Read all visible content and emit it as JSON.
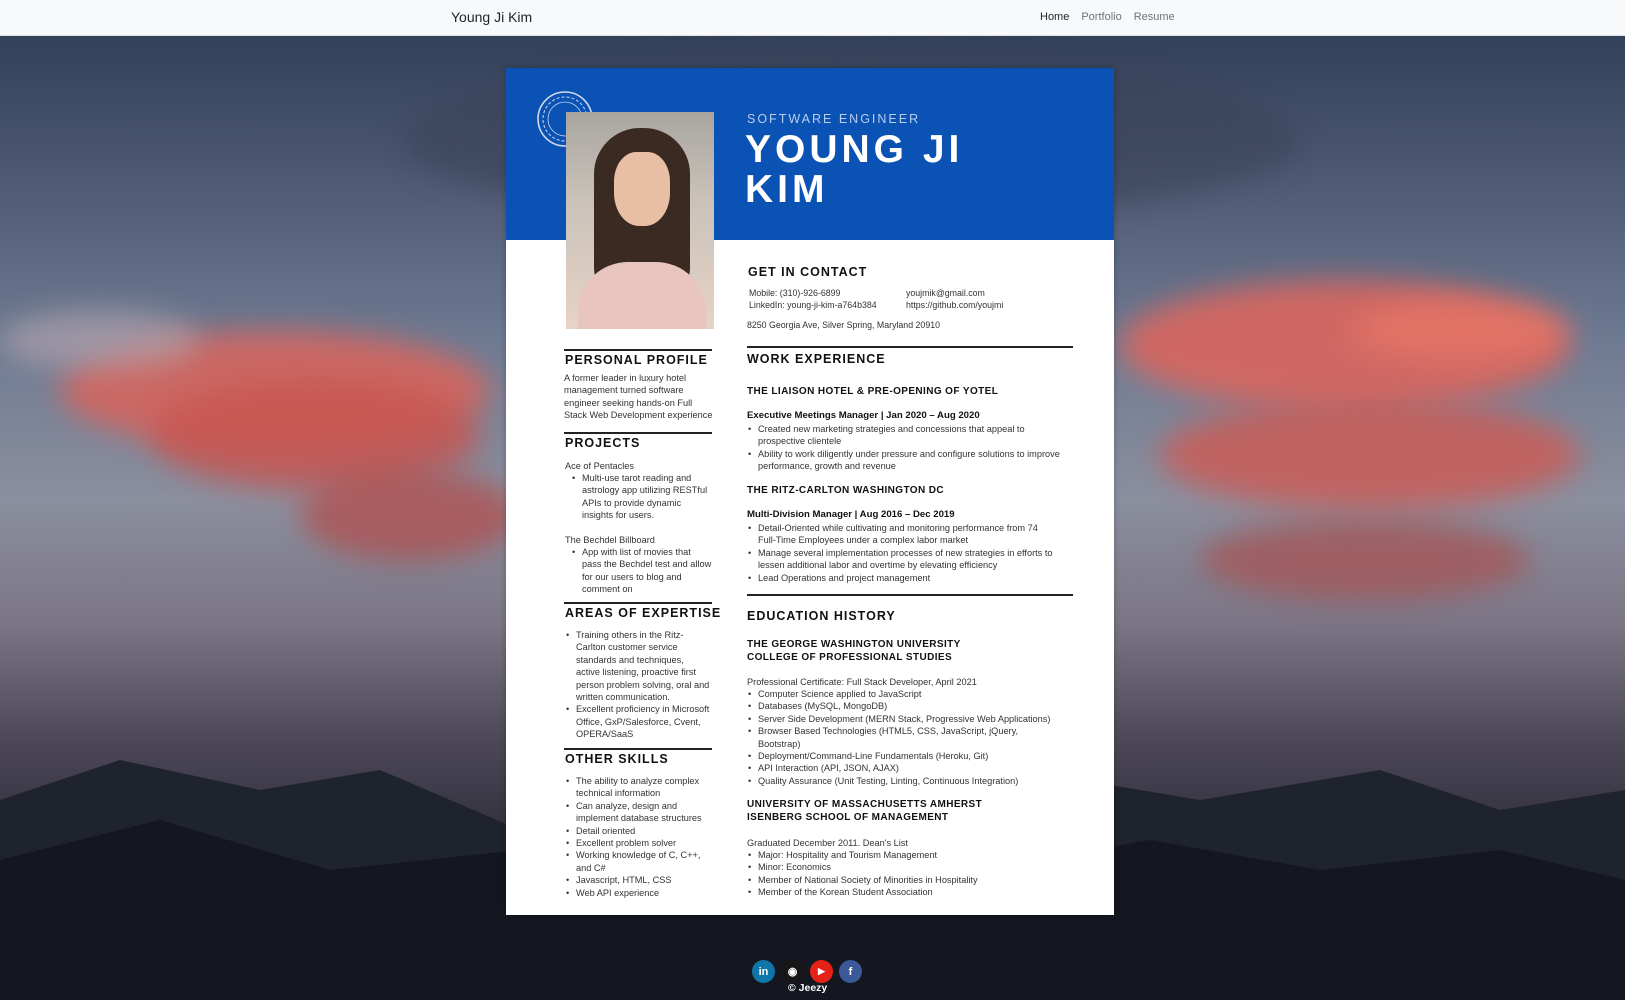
{
  "navbar": {
    "brand": "Young Ji Kim",
    "links": [
      {
        "label": "Home",
        "active": true
      },
      {
        "label": "Portfolio",
        "active": false
      },
      {
        "label": "Resume",
        "active": false
      }
    ]
  },
  "resume": {
    "role": "SOFTWARE ENGINEER",
    "name_line1": "YOUNG JI",
    "name_line2": "KIM",
    "accent_color": "#0b52b5",
    "contact": {
      "heading": "GET IN CONTACT",
      "mobile": "Mobile: (310)-926-6899",
      "linkedin": "LinkedIn: young-ji-kim-a764b384",
      "email": "youjmik@gmail.com",
      "github": "https://github.com/youjmi",
      "address": "8250 Georgia Ave, Silver Spring, Maryland 20910"
    },
    "profile": {
      "heading": "PERSONAL PROFILE",
      "lines": [
        "A former leader in luxury hotel",
        "management turned software",
        "engineer seeking hands-on Full",
        "Stack Web Development experience"
      ]
    },
    "projects": {
      "heading": "PROJECTS",
      "p1_title": "Ace of Pentacles",
      "p1_bullet": [
        "Multi-use tarot reading and",
        "astrology app utilizing RESTful",
        "APIs to provide dynamic",
        "insights for users."
      ],
      "p2_title": "The Bechdel Billboard",
      "p2_bullet": [
        "App with list of movies that",
        "pass the Bechdel test and allow",
        "for our users to blog and",
        "comment on"
      ]
    },
    "expertise": {
      "heading": "AREAS OF EXPERTISE",
      "b1": [
        "Training others in the Ritz-",
        "Carlton customer service",
        "standards and techniques,",
        "active listening, proactive first",
        "person problem solving, oral and",
        "written communication."
      ],
      "b2": [
        "Excellent proficiency in Microsoft",
        "Office, GxP/Salesforce, Cvent,",
        "OPERA/SaaS"
      ]
    },
    "skills": {
      "heading": "OTHER SKILLS",
      "items": [
        [
          "The ability to analyze complex",
          "technical information"
        ],
        [
          "Can analyze, design and",
          "implement database structures"
        ],
        [
          "Detail oriented"
        ],
        [
          "Excellent problem solver"
        ],
        [
          "Working knowledge of C, C++,",
          "and C#"
        ],
        [
          "Javascript, HTML, CSS"
        ],
        [
          "Web API experience"
        ]
      ]
    },
    "work": {
      "heading": "WORK EXPERIENCE",
      "job1_company": "THE LIAISON HOTEL & PRE-OPENING OF YOTEL",
      "job1_title": "Executive Meetings Manager | Jan 2020 – Aug 2020",
      "job1_bullets": [
        [
          "Created new marketing strategies and concessions that appeal to",
          "prospective clientele"
        ],
        [
          "Ability to work diligently under pressure and configure solutions to improve",
          "performance, growth and revenue"
        ]
      ],
      "job2_company": "THE RITZ-CARLTON WASHINGTON DC",
      "job2_title": "Multi-Division Manager | Aug 2016 – Dec 2019",
      "job2_bullets": [
        [
          "Detail-Oriented while cultivating and monitoring performance from 74",
          "Full-Time Employees under a complex labor market"
        ],
        [
          "Manage several implementation processes of new strategies in efforts to",
          "lessen additional labor and overtime by elevating efficiency"
        ],
        [
          "Lead Operations and project management"
        ]
      ]
    },
    "education": {
      "heading": "EDUCATION HISTORY",
      "school1_line1": "THE GEORGE WASHINGTON UNIVERSITY",
      "school1_line2": "COLLEGE OF PROFESSIONAL STUDIES",
      "school1_cert": "Professional Certificate: Full Stack Developer, April 2021",
      "school1_bullets": [
        [
          "Computer Science applied to JavaScript"
        ],
        [
          "Databases (MySQL, MongoDB)"
        ],
        [
          "Server Side Development (MERN Stack, Progressive Web Applications)"
        ],
        [
          "Browser Based Technologies (HTML5, CSS, JavaScript, jQuery,",
          "Bootstrap)"
        ],
        [
          "Deployment/Command-Line Fundamentals (Heroku, Git)"
        ],
        [
          "API Interaction (API, JSON, AJAX)"
        ],
        [
          "Quality Assurance (Unit Testing, Linting, Continuous Integration)"
        ]
      ],
      "school2_line1": "UNIVERSITY OF MASSACHUSETTS AMHERST",
      "school2_line2": "ISENBERG SCHOOL OF MANAGEMENT",
      "school2_grad": "Graduated December 2011. Dean's List",
      "school2_bullets": [
        [
          "Major: Hospitality and Tourism Management"
        ],
        [
          "Minor: Economics"
        ],
        [
          "Member of National Society of Minorities in Hospitality"
        ],
        [
          "Member of the Korean Student Association"
        ]
      ]
    }
  },
  "footer": {
    "social": [
      {
        "icon": "linkedin-icon",
        "glyph": "in",
        "color": "#0e76a8"
      },
      {
        "icon": "github-icon",
        "glyph": "◉",
        "color": "#171515"
      },
      {
        "icon": "youtube-icon",
        "glyph": "▶",
        "color": "#e62117"
      },
      {
        "icon": "facebook-icon",
        "glyph": "f",
        "color": "#3b5998"
      }
    ],
    "copyright": "© Jeezy"
  }
}
